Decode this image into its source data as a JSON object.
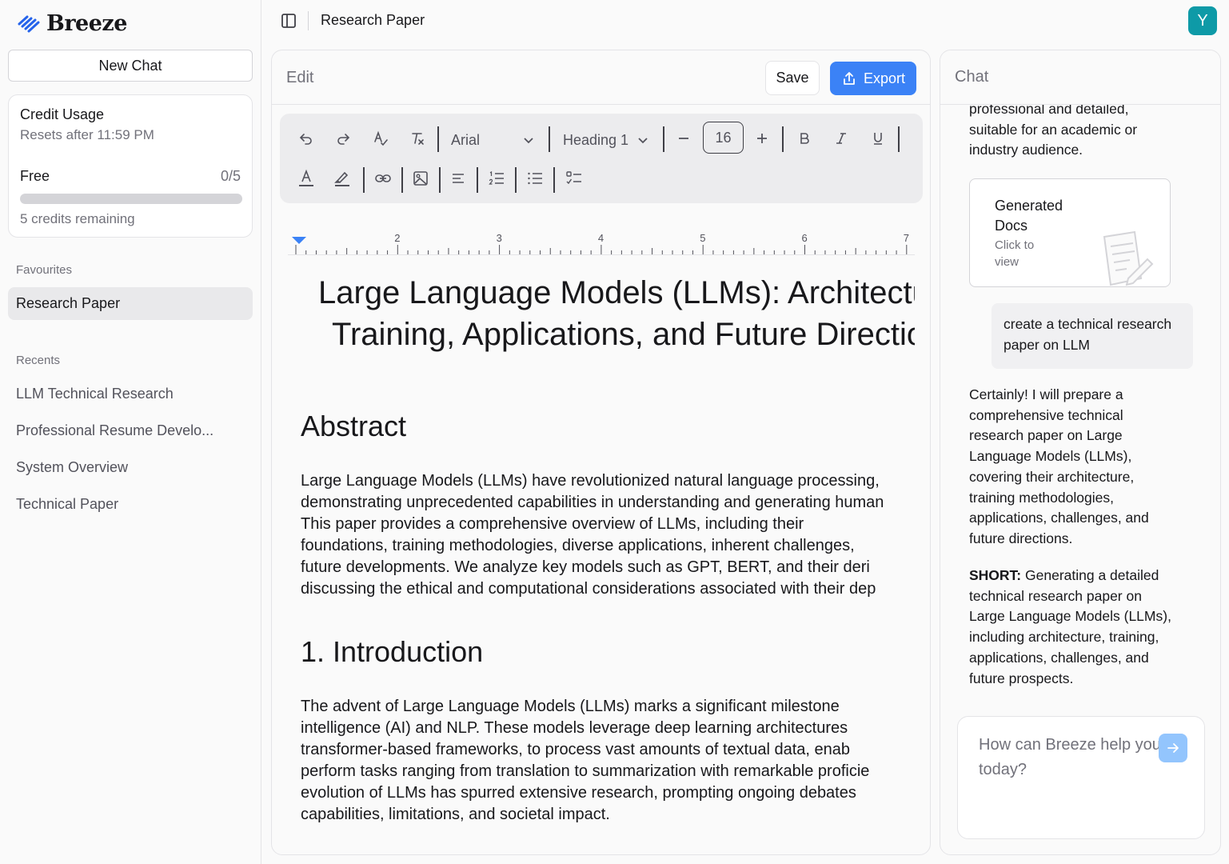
{
  "app": {
    "name": "Breeze"
  },
  "sidebar": {
    "new_chat": "New Chat",
    "credit": {
      "title": "Credit Usage",
      "reset": "Resets after 11:59 PM",
      "plan": "Free",
      "count": "0/5",
      "used_fraction": 0,
      "remaining": "5 credits remaining"
    },
    "favourites_label": "Favourites",
    "favourites": [
      "Research Paper"
    ],
    "recents_label": "Recents",
    "recents": [
      "LLM Technical Research",
      "Professional Resume Develo...",
      "System Overview",
      "Technical Paper"
    ]
  },
  "topbar": {
    "title": "Research Paper",
    "avatar": "Y"
  },
  "editor": {
    "label": "Edit",
    "save": "Save",
    "export": "Export",
    "font": "Arial",
    "heading": "Heading 1",
    "font_size": "16",
    "ruler_labels": [
      "2",
      "3",
      "4",
      "5",
      "6",
      "7"
    ]
  },
  "doc": {
    "title_line1": "Large Language Models (LLMs): Architecture,",
    "title_line2": "Training, Applications, and Future Directions",
    "abstract_heading": "Abstract",
    "abstract_lines": [
      "Large Language Models (LLMs) have revolutionized natural language processing,",
      "demonstrating unprecedented capabilities in understanding and generating human",
      "This paper provides a comprehensive overview of LLMs, including their",
      "foundations, training methodologies, diverse applications, inherent challenges,",
      "future developments. We analyze key models such as GPT, BERT, and their deri",
      "discussing the ethical and computational considerations associated with their dep"
    ],
    "intro_heading": "1. Introduction",
    "intro_lines": [
      "The advent of Large Language Models (LLMs) marks a significant milestone",
      "intelligence (AI) and NLP. These models leverage deep learning architectures",
      "transformer-based frameworks, to process vast amounts of textual data, enab",
      "perform tasks ranging from translation to summarization with remarkable proficie",
      "evolution of LLMs has spurred extensive research, prompting ongoing debates",
      "capabilities, limitations, and societal impact."
    ]
  },
  "chat": {
    "label": "Chat",
    "msg_top": "professional and detailed, suitable for an academic or industry audience.",
    "doc_card_title": "Generated Docs",
    "doc_card_sub": "Click to view",
    "user_msg": "create a technical research paper on LLM",
    "reply": "Certainly! I will prepare a comprehensive technical research paper on Large Language Models (LLMs), covering their architecture, training methodologies, applications, challenges, and future directions.",
    "short_label": "SHORT:",
    "short_text": " Generating a detailed technical research paper on Large Language Models (LLMs), including architecture, training, applications, challenges, and future prospects.",
    "input_placeholder": "How can Breeze help you today?"
  },
  "colors": {
    "accent": "#3b82f6",
    "avatar": "#0e9aa7"
  }
}
